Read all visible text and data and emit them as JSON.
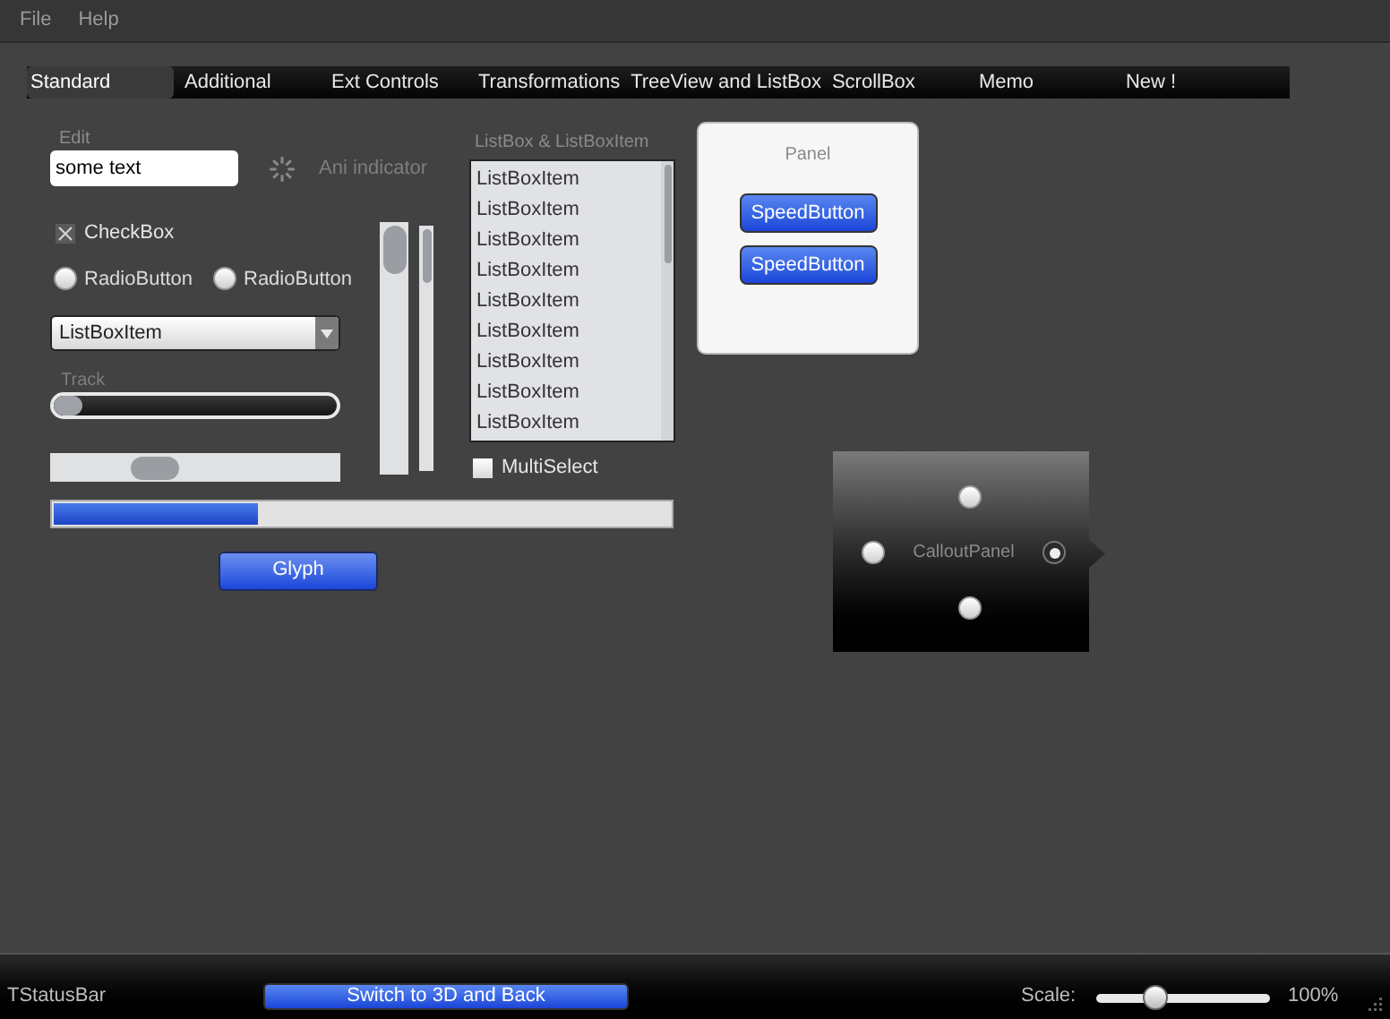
{
  "menu": [
    "File",
    "Help"
  ],
  "tabs": [
    {
      "label": "Standard",
      "selected": true
    },
    {
      "label": "Additional",
      "selected": false
    },
    {
      "label": "Ext Controls",
      "selected": false
    },
    {
      "label": "Transformations",
      "selected": false
    },
    {
      "label": "TreeView and ListBox",
      "selected": false
    },
    {
      "label": "ScrollBox",
      "selected": false
    },
    {
      "label": "Memo",
      "selected": false
    },
    {
      "label": "New !",
      "selected": false
    }
  ],
  "edit": {
    "label": "Edit",
    "value": "some text"
  },
  "ani_indicator": {
    "label": "Ani indicator"
  },
  "checkbox": {
    "label": "CheckBox",
    "checked": true
  },
  "radios": [
    {
      "label": "RadioButton",
      "selected": false
    },
    {
      "label": "RadioButton",
      "selected": false
    }
  ],
  "combo": {
    "value": "ListBoxItem"
  },
  "track": {
    "label": "Track",
    "level": 0.1
  },
  "progress": {
    "level": 0.33
  },
  "glyph_button": "Glyph",
  "listbox": {
    "label": "ListBox & ListBoxItem",
    "items": [
      "ListBoxItem",
      "ListBoxItem",
      "ListBoxItem",
      "ListBoxItem",
      "ListBoxItem",
      "ListBoxItem",
      "ListBoxItem",
      "ListBoxItem",
      "ListBoxItem"
    ]
  },
  "multiselect": {
    "label": "MultiSelect",
    "checked": false
  },
  "panel": {
    "title": "Panel",
    "buttons": [
      "SpeedButton",
      "SpeedButton"
    ]
  },
  "callout_panel": {
    "title": "CalloutPanel",
    "radios": [
      {
        "kind": "top",
        "selected": false
      },
      {
        "kind": "left",
        "selected": false
      },
      {
        "kind": "right",
        "selected": true
      },
      {
        "kind": "bottom",
        "selected": false
      }
    ]
  },
  "status_bar": {
    "text": "TStatusBar",
    "button": "Switch to 3D and Back",
    "scale_label": "Scale:",
    "scale": {
      "level": 0.34
    },
    "scale_value": "100%"
  }
}
